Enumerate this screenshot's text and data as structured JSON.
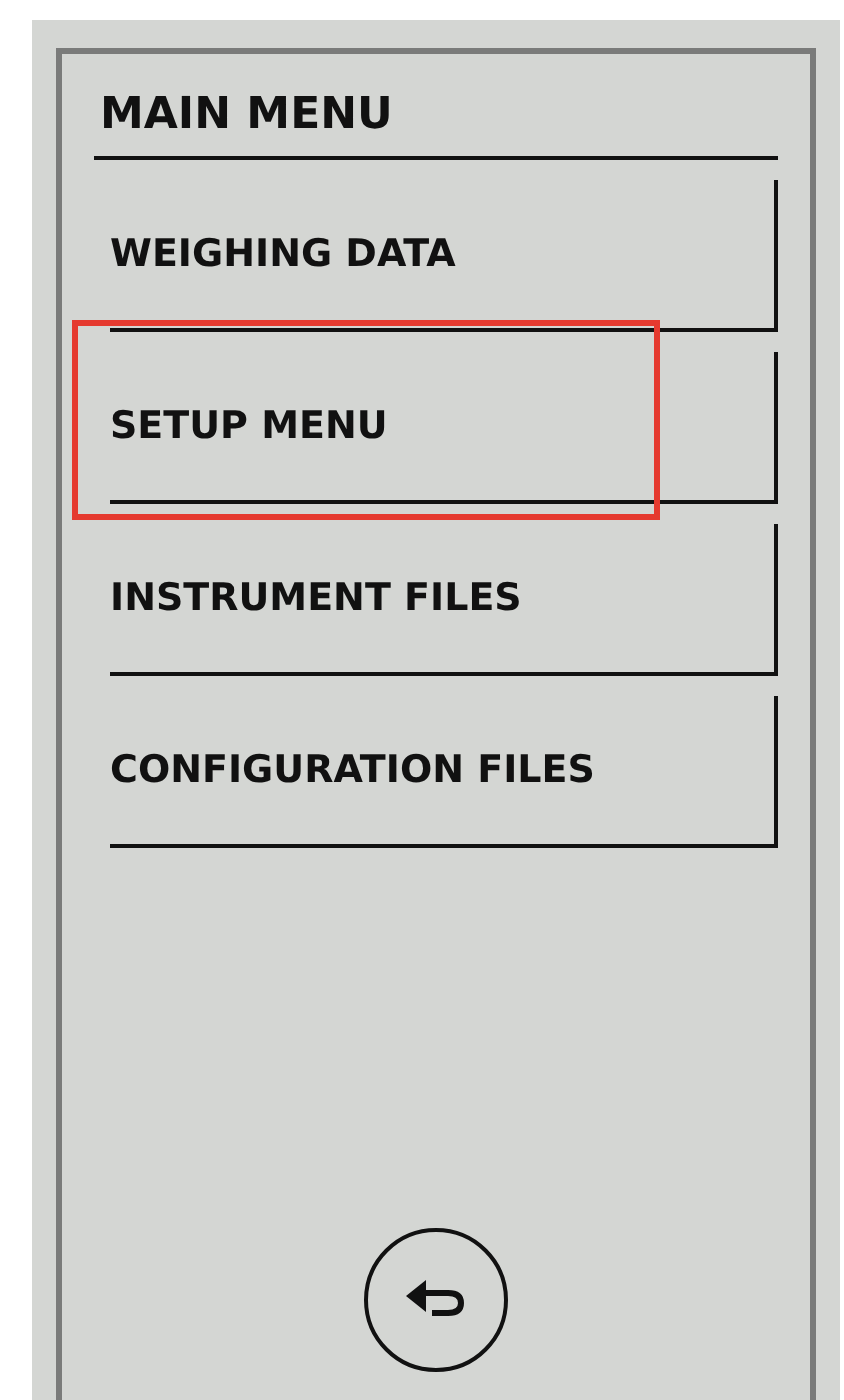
{
  "title": "MAIN MENU",
  "menu_items": [
    {
      "label": "WEIGHING DATA",
      "highlighted": false
    },
    {
      "label": "SETUP MENU",
      "highlighted": true
    },
    {
      "label": "INSTRUMENT FILES",
      "highlighted": false
    },
    {
      "label": "CONFIGURATION FILES",
      "highlighted": false
    }
  ],
  "back_button": {
    "kind": "back"
  }
}
